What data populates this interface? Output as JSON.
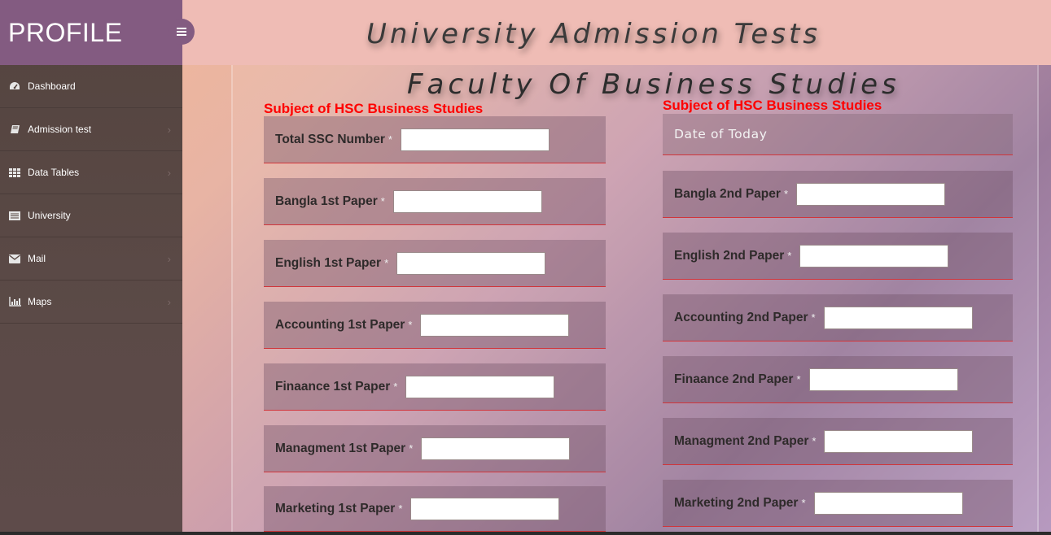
{
  "brand": {
    "title": "PROFILE"
  },
  "header": {
    "title": "University Admission Tests"
  },
  "sidebar": {
    "items": [
      {
        "label": "Dashboard",
        "icon": "dashboard-icon",
        "chevron": false
      },
      {
        "label": "Admission test",
        "icon": "book-icon",
        "chevron": true
      },
      {
        "label": "Data Tables",
        "icon": "table-icon",
        "chevron": true
      },
      {
        "label": "University",
        "icon": "list-icon",
        "chevron": false
      },
      {
        "label": "Mail",
        "icon": "envelope-icon",
        "chevron": true
      },
      {
        "label": "Maps",
        "icon": "bar-chart-icon",
        "chevron": true
      }
    ]
  },
  "main": {
    "faculty_title": "Faculty Of Business Studies",
    "left": {
      "subject": "Subject of HSC Business Studies",
      "fields": [
        {
          "label": "Total SSC Number",
          "value": ""
        },
        {
          "label": "Bangla 1st Paper",
          "value": ""
        },
        {
          "label": "English 1st Paper",
          "value": ""
        },
        {
          "label": "Accounting 1st Paper",
          "value": ""
        },
        {
          "label": "Finaance 1st Paper",
          "value": ""
        },
        {
          "label": "Managment 1st Paper",
          "value": ""
        },
        {
          "label": "Marketing 1st Paper",
          "value": ""
        }
      ]
    },
    "right": {
      "subject": "Subject of HSC Business Studies",
      "date_label": "Date of Today",
      "fields": [
        {
          "label": "Bangla 2nd Paper",
          "value": ""
        },
        {
          "label": "English 2nd Paper",
          "value": ""
        },
        {
          "label": "Accounting 2nd Paper",
          "value": ""
        },
        {
          "label": "Finaance 2nd Paper",
          "value": ""
        },
        {
          "label": "Managment 2nd Paper",
          "value": ""
        },
        {
          "label": "Marketing 2nd Paper",
          "value": ""
        }
      ]
    },
    "required_marker": "*"
  },
  "colors": {
    "brand_bg": "#835b81",
    "sidebar_bg": "#5a4848",
    "header_bg": "#efbcb5",
    "subject_text": "#ff0000",
    "row_border": "#d0353b"
  }
}
